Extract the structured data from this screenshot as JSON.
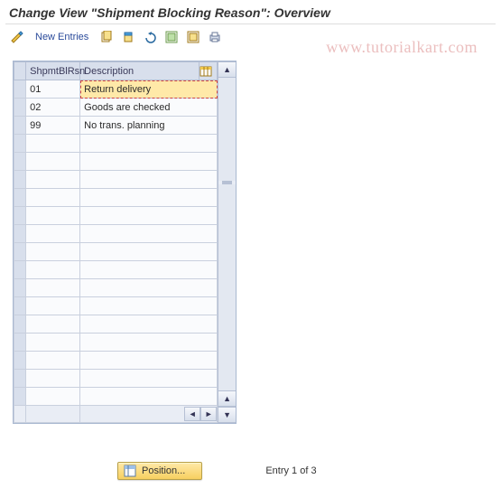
{
  "header": {
    "title": "Change View \"Shipment Blocking Reason\": Overview"
  },
  "toolbar": {
    "new_entries_label": "New Entries"
  },
  "watermark": "www.tutorialkart.com",
  "grid": {
    "columns": {
      "code": "ShpmtBlRsn",
      "desc": "Description"
    },
    "rows": [
      {
        "code": "01",
        "desc": "Return delivery",
        "selected": true
      },
      {
        "code": "02",
        "desc": "Goods are checked"
      },
      {
        "code": "99",
        "desc": "No trans. planning"
      }
    ],
    "empty_rows": 15
  },
  "footer": {
    "position_label": "Position...",
    "entry_text": "Entry 1 of 3"
  }
}
